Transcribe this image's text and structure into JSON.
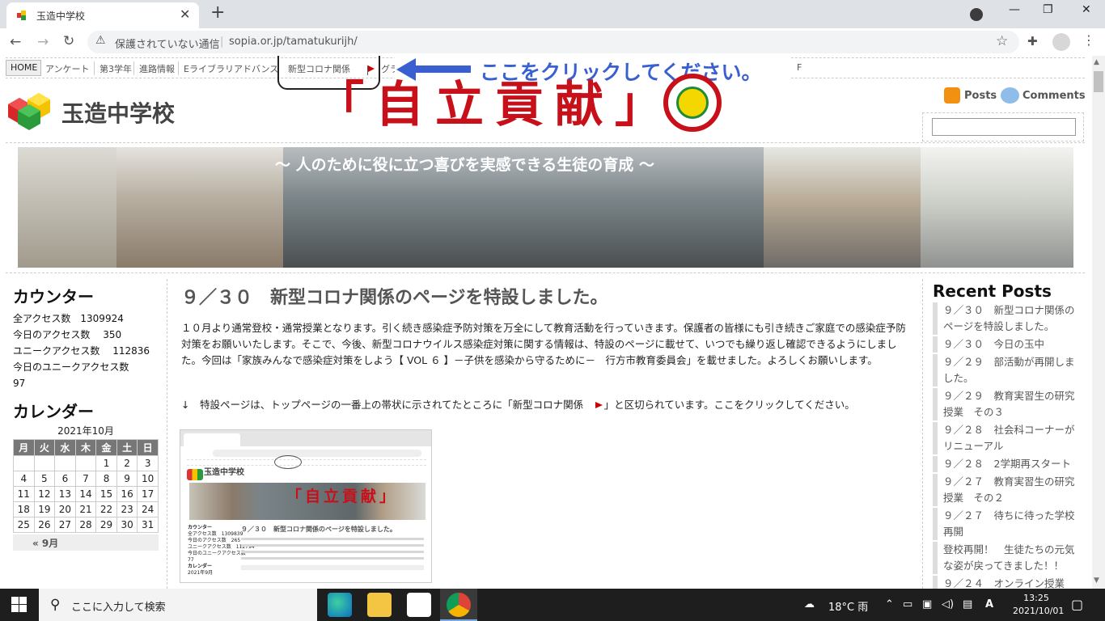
{
  "browser": {
    "tab_title": "玉造中学校",
    "tab_close": "✕",
    "new_tab": "+",
    "insecure_label": "保護されていない通信",
    "separator": "|",
    "url": "sopia.or.jp/tamatukurijh/",
    "back": "←",
    "forward": "→",
    "reload": "↻",
    "minimize": "—",
    "restore": "❐",
    "close": "✕",
    "star": "☆",
    "menu": "⋮"
  },
  "site": {
    "title": "玉造中学校",
    "nav": [
      {
        "label": "HOME"
      },
      {
        "label": "アンケート"
      },
      {
        "label": "第3学年"
      },
      {
        "label": "進路情報"
      },
      {
        "label": "Eライブラリアドバンス"
      },
      {
        "label": "新型コロナ関係"
      },
      {
        "label": "グラ"
      },
      {
        "label": "校"
      },
      {
        "label": "F"
      }
    ],
    "callout": "ここをクリックしてください。",
    "rss_posts": "Posts",
    "rss_comments": "Comments",
    "banner_motto": "「自立貢献」",
    "banner_sub": "〜 人のために役に立つ喜びを実感できる生徒の育成 〜"
  },
  "counter": {
    "title": "カウンター",
    "lines": [
      "全アクセス数　1309924",
      "今日のアクセス数　 350",
      "ユニークアクセス数　 112836",
      "今日のユニークアクセス数",
      "97"
    ]
  },
  "calendar": {
    "title": "カレンダー",
    "caption": "2021年10月",
    "weekdays": [
      "月",
      "火",
      "水",
      "木",
      "金",
      "土",
      "日"
    ],
    "weeks": [
      [
        "",
        "",
        "",
        "",
        "1",
        "2",
        "3"
      ],
      [
        "4",
        "5",
        "6",
        "7",
        "8",
        "9",
        "10"
      ],
      [
        "11",
        "12",
        "13",
        "14",
        "15",
        "16",
        "17"
      ],
      [
        "18",
        "19",
        "20",
        "21",
        "22",
        "23",
        "24"
      ],
      [
        "25",
        "26",
        "27",
        "28",
        "29",
        "30",
        "31"
      ]
    ],
    "prev": "« 9月"
  },
  "post": {
    "title": "９／３０　新型コロナ関係のページを特設しました。",
    "body": "１０月より通常登校・通常授業となります。引く続き感染症予防対策を万全にして教育活動を行っていきます。保護者の皆様にも引き続きご家庭での感染症予防対策をお願いいたします。そこで、今後、新型コロナウイルス感染症対策に関する情報は、特設のページに載せて、いつでも繰り返し確認できるようにしました。今回は「家族みんなで感染症対策をしよう【 VOL ６ 】－子供を感染から守るために－　行方市教育委員会」を載せました。よろしくお願いします。",
    "arrow_before": "↓　特設ページは、トップページの一番上の帯状に示されてたところに「新型コロナ関係　",
    "arrow_after": "」と区切られています。ここをクリックしてください。",
    "thumb": {
      "site": "玉造中学校",
      "motto": "「自立貢献」",
      "side": [
        "カウンター",
        "全アクセス数　1309839",
        "今日のアクセス数　265",
        "ユニークアクセス数　112794",
        "今日のユニークアクセス数",
        "77",
        "カレンダー",
        "2021年9月"
      ],
      "title": "９／３０　新型コロナ関係のページを特設しました。"
    }
  },
  "recent": {
    "title": "Recent Posts",
    "items": [
      "９／３０　新型コロナ関係のページを特設しました。",
      "９／３０　今日の玉中",
      "９／２９　部活動が再開しました。",
      "９／２９　教育実習生の研究授業　その３",
      "９／２８　社会科コーナーがリニューアル",
      "９／２８　2学期再スタート",
      "９／２７　教育実習生の研究授業　その２",
      "９／２７　待ちに待った学校再開",
      "登校再開！　生徒たちの元気な姿が戻ってきました！！",
      "９／２４　オンライン授業"
    ]
  },
  "taskbar": {
    "search_placeholder": "ここに入力して検索",
    "weather": "18°C  雨",
    "ime": "A",
    "time": "13:25",
    "date": "2021/10/01"
  }
}
